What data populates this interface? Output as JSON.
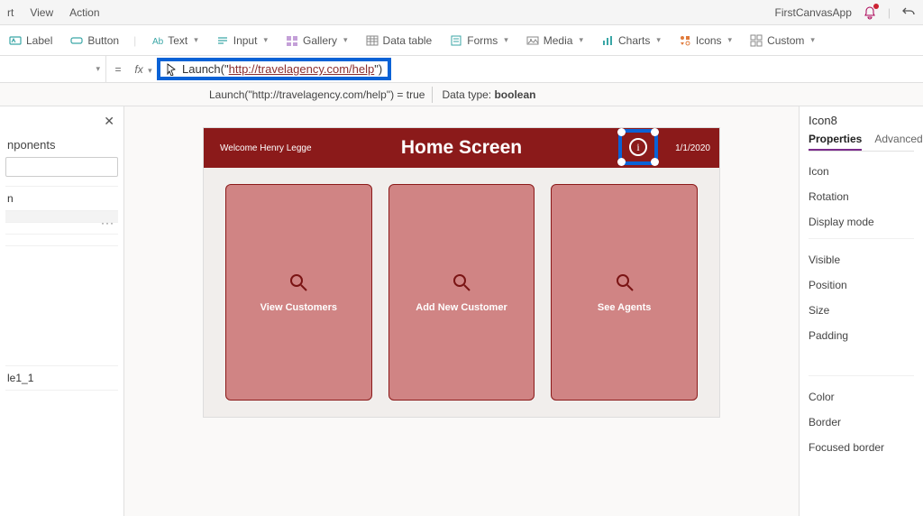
{
  "topmenu": {
    "rt": "rt",
    "view": "View",
    "action": "Action"
  },
  "topright": {
    "appname": "FirstCanvasApp"
  },
  "ribbon": {
    "label": "Label",
    "button": "Button",
    "text": "Text",
    "input": "Input",
    "gallery": "Gallery",
    "datatable": "Data table",
    "forms": "Forms",
    "media": "Media",
    "charts": "Charts",
    "icons": "Icons",
    "custom": "Custom"
  },
  "formula": {
    "eq": "=",
    "fx": "fx",
    "fn": "Launch",
    "open": "(",
    "q1": "\"",
    "url": "http://travelagency.com/help",
    "q2": "\"",
    "close": ")",
    "result_left": "Launch(\"http://travelagency.com/help\")  =  true",
    "dt_label": "Data type: ",
    "dt_value": "boolean"
  },
  "left": {
    "head": "nponents",
    "items": [
      "n",
      "",
      "",
      "",
      "",
      "le1_1",
      ""
    ]
  },
  "canvas": {
    "welcome": "Welcome Henry Legge",
    "title": "Home Screen",
    "date": "1/1/2020",
    "cards": [
      "View Customers",
      "Add New Customer",
      "See Agents"
    ]
  },
  "right": {
    "selected": "Icon8",
    "tabs": {
      "properties": "Properties",
      "advanced": "Advanced"
    },
    "props1": [
      "Icon",
      "Rotation",
      "Display mode"
    ],
    "props2": [
      "Visible",
      "Position",
      "Size",
      "Padding"
    ],
    "props3": [
      "Color",
      "Border",
      "Focused border"
    ]
  }
}
